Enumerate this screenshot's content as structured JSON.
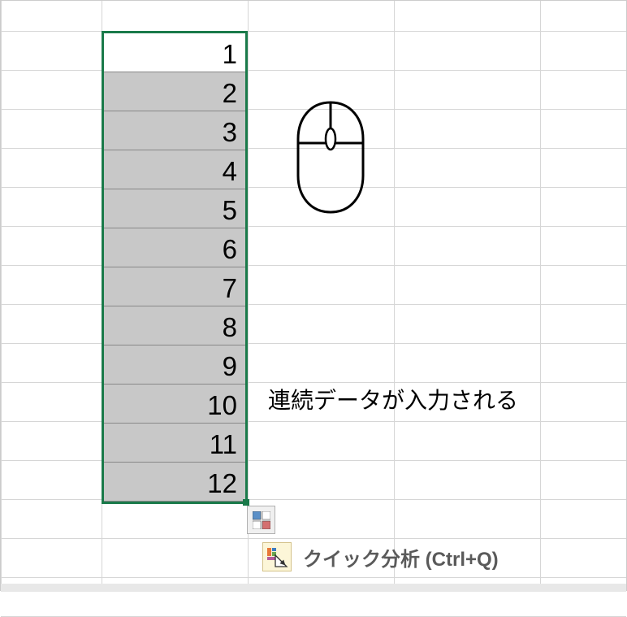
{
  "cells": [
    "1",
    "2",
    "3",
    "4",
    "5",
    "6",
    "7",
    "8",
    "9",
    "10",
    "11",
    "12"
  ],
  "annotation": "連続データが入力される",
  "quickAnalysis": {
    "label": "クイック分析 (Ctrl+Q)"
  },
  "gridRows": [
    0,
    48,
    96,
    144,
    192,
    240,
    288,
    336,
    384,
    432,
    480,
    528,
    576,
    624,
    672,
    720
  ],
  "gridOffset": 37,
  "gridCols": [
    0,
    124,
    304,
    484,
    664,
    772
  ]
}
